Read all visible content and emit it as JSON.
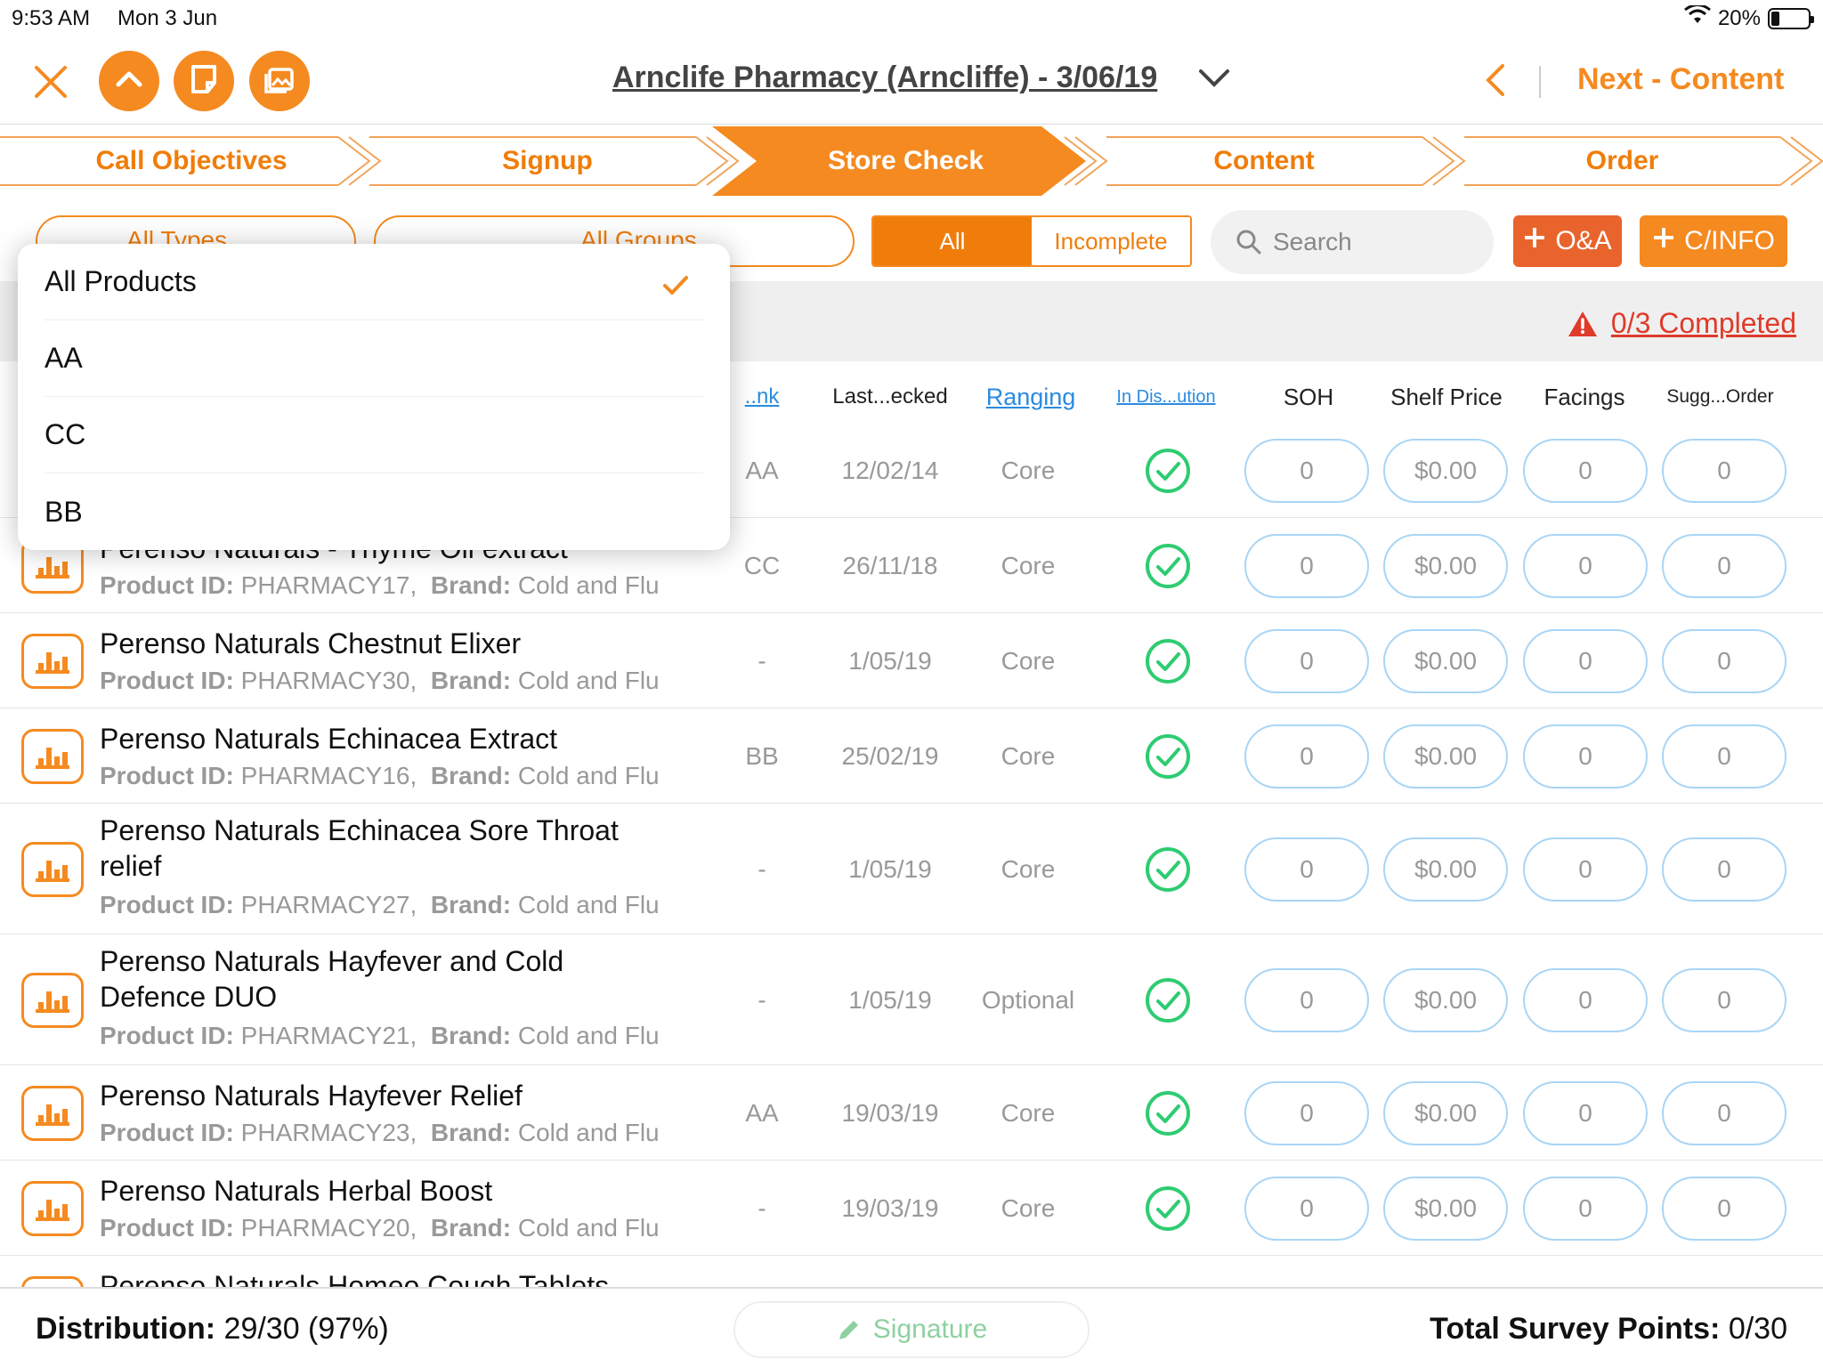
{
  "status": {
    "time": "9:53 AM",
    "date": "Mon 3 Jun",
    "battery": "20%",
    "battery_level": 0.2
  },
  "header": {
    "title": "Arnclife Pharmacy (Arncliffe) - 3/06/19",
    "next_label": "Next - Content"
  },
  "tabs": [
    {
      "label": "Call Objectives",
      "active": false
    },
    {
      "label": "Signup",
      "active": false
    },
    {
      "label": "Store Check",
      "active": true
    },
    {
      "label": "Content",
      "active": false
    },
    {
      "label": "Order",
      "active": false
    }
  ],
  "filters": {
    "types_label": "All Types",
    "groups_label": "All Groups",
    "segment_all": "All",
    "segment_incomplete": "Incomplete",
    "search_placeholder": "Search",
    "qa_label": "O&A",
    "cinfo_label": "C/INFO"
  },
  "summary": {
    "completed": "0/3 Completed"
  },
  "columns": {
    "rank": "..nk",
    "last_checked": "Last...ecked",
    "ranging": "Ranging",
    "in_distribution": "In Dis...ution",
    "soh": "SOH",
    "shelf_price": "Shelf Price",
    "facings": "Facings",
    "sugg_order": "Sugg...Order"
  },
  "labels": {
    "product_id": "Product ID:",
    "brand": "Brand:"
  },
  "rows": [
    {
      "name": "",
      "product_id": "",
      "brand": "",
      "rank": "AA",
      "last_checked": "12/02/14",
      "ranging": "Core",
      "soh": "0",
      "price": "$0.00",
      "facings": "0",
      "sugg": "0"
    },
    {
      "name": "Perenso Naturals - Thyme Oil extract",
      "product_id": "PHARMACY17,",
      "brand": "Cold and Flu",
      "rank": "CC",
      "last_checked": "26/11/18",
      "ranging": "Core",
      "soh": "0",
      "price": "$0.00",
      "facings": "0",
      "sugg": "0"
    },
    {
      "name": "Perenso Naturals Chestnut Elixer",
      "product_id": "PHARMACY30,",
      "brand": "Cold and Flu",
      "rank": "-",
      "last_checked": "1/05/19",
      "ranging": "Core",
      "soh": "0",
      "price": "$0.00",
      "facings": "0",
      "sugg": "0"
    },
    {
      "name": "Perenso Naturals Echinacea Extract",
      "product_id": "PHARMACY16,",
      "brand": "Cold and Flu",
      "rank": "BB",
      "last_checked": "25/02/19",
      "ranging": "Core",
      "soh": "0",
      "price": "$0.00",
      "facings": "0",
      "sugg": "0"
    },
    {
      "name": "Perenso Naturals Echinacea Sore Throat relief",
      "product_id": "PHARMACY27,",
      "brand": "Cold and Flu",
      "rank": "-",
      "last_checked": "1/05/19",
      "ranging": "Core",
      "soh": "0",
      "price": "$0.00",
      "facings": "0",
      "sugg": "0"
    },
    {
      "name": "Perenso Naturals Hayfever and Cold Defence DUO",
      "product_id": "PHARMACY21,",
      "brand": "Cold and Flu",
      "rank": "-",
      "last_checked": "1/05/19",
      "ranging": "Optional",
      "soh": "0",
      "price": "$0.00",
      "facings": "0",
      "sugg": "0"
    },
    {
      "name": "Perenso Naturals Hayfever Relief",
      "product_id": "PHARMACY23,",
      "brand": "Cold and Flu",
      "rank": "AA",
      "last_checked": "19/03/19",
      "ranging": "Core",
      "soh": "0",
      "price": "$0.00",
      "facings": "0",
      "sugg": "0"
    },
    {
      "name": "Perenso Naturals Herbal Boost",
      "product_id": "PHARMACY20,",
      "brand": "Cold and Flu",
      "rank": "-",
      "last_checked": "19/03/19",
      "ranging": "Core",
      "soh": "0",
      "price": "$0.00",
      "facings": "0",
      "sugg": "0"
    },
    {
      "name": "Perenso Naturals Homeo Cough Tablets",
      "product_id": "",
      "brand": "",
      "rank": "",
      "last_checked": "",
      "ranging": "",
      "soh": "",
      "price": "",
      "facings": "",
      "sugg": ""
    }
  ],
  "dropdown": {
    "items": [
      {
        "label": "All Products",
        "selected": true
      },
      {
        "label": "AA",
        "selected": false
      },
      {
        "label": "CC",
        "selected": false
      },
      {
        "label": "BB",
        "selected": false
      }
    ]
  },
  "footer": {
    "distribution_label": "Distribution:",
    "distribution_value": "29/30 (97%)",
    "signature_label": "Signature",
    "points_label": "Total Survey Points:",
    "points_value": "0/30"
  },
  "colors": {
    "accent": "#f58a20",
    "accent_dark": "#f07d0a",
    "qa_button": "#e8642c",
    "check": "#2ecc71",
    "warning": "#e03a2a",
    "link": "#2a8be0",
    "pill_border": "#a9d5f5"
  },
  "icons": [
    "close-icon",
    "chevron-up-icon",
    "note-icon",
    "gallery-icon",
    "chevron-down-icon",
    "chevron-left-icon",
    "menu-icon",
    "search-icon",
    "plus-icon",
    "warning-icon",
    "bar-chart-icon",
    "check-circle-icon",
    "checkmark-icon",
    "pencil-icon",
    "wifi-icon",
    "battery-icon"
  ]
}
